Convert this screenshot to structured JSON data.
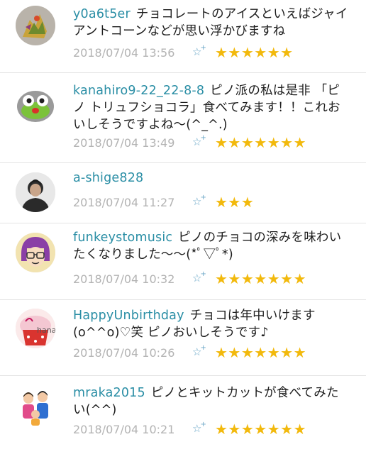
{
  "comments": [
    {
      "user": "y0a6t5er",
      "text": "チョコレートのアイスといえばジャイアントコーンなどが思い浮かびますね",
      "time": "2018/07/04 13:56",
      "stars": "★★★★★★",
      "avatar_icon": "dragon-figure-avatar"
    },
    {
      "user": "kanahiro9-22_22-8-8",
      "text": "ピノ派の私は是非 「ピノ トリュフショコラ」食べてみます！！これおいしそうですよね～(^_^.)",
      "time": "2018/07/04 13:49",
      "stars": "★★★★★★★",
      "avatar_icon": "green-robot-avatar"
    },
    {
      "user": "a-shige828",
      "text": "",
      "time": "2018/07/04 11:27",
      "stars": "★★★",
      "avatar_icon": "person-photo-avatar"
    },
    {
      "user": "funkeystomusic",
      "text": "ピノのチョコの深みを味わいたくなりました～～(*ﾟ▽ﾟ*)",
      "time": "2018/07/04 10:32",
      "stars": "★★★★★★★",
      "avatar_icon": "glasses-face-avatar"
    },
    {
      "user": "HappyUnbirthday",
      "text": "チョコは年中いけます(o^^o)♡笑 ピノおいしそうです♪",
      "time": "2018/07/04 10:26",
      "stars": "★★★★★★★",
      "avatar_icon": "cupcake-hana-avatar",
      "avatar_caption": "hana"
    },
    {
      "user": "mraka2015",
      "text": "ピノとキットカットが食べてみたい(^^)",
      "time": "2018/07/04 10:21",
      "stars": "★★★★★★★",
      "avatar_icon": "family-illustration-avatar"
    }
  ],
  "add_star_glyph": "☆",
  "add_star_plus": "+",
  "colors": {
    "username": "#2a8ea5",
    "timestamp": "#b3b3b3",
    "star": "#f2b90c",
    "add_star": "#6aa7c7"
  }
}
